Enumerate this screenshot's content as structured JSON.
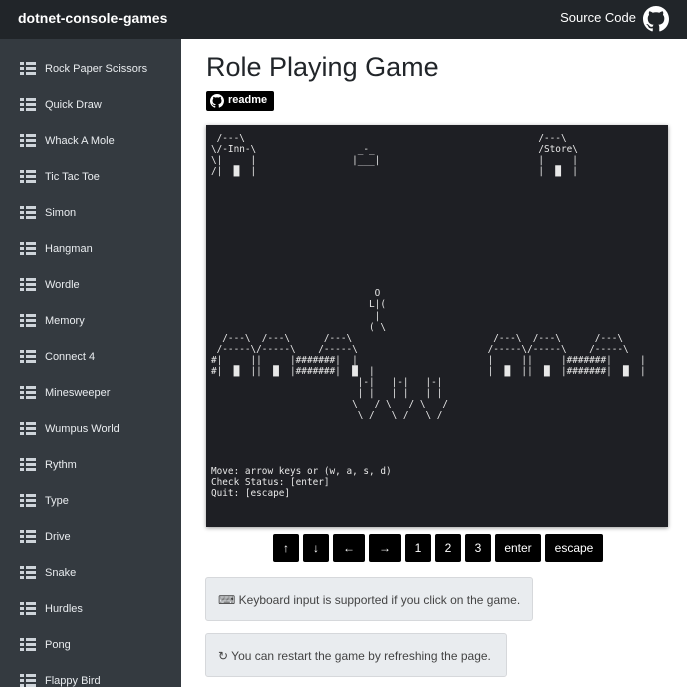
{
  "header": {
    "brand": "dotnet-console-games",
    "source_code_label": "Source Code",
    "github_icon": "github-icon"
  },
  "sidebar": {
    "items": [
      {
        "label": "Rock Paper Scissors",
        "icon": "list-icon"
      },
      {
        "label": "Quick Draw",
        "icon": "list-icon"
      },
      {
        "label": "Whack A Mole",
        "icon": "list-icon"
      },
      {
        "label": "Tic Tac Toe",
        "icon": "list-icon"
      },
      {
        "label": "Simon",
        "icon": "list-icon"
      },
      {
        "label": "Hangman",
        "icon": "list-icon"
      },
      {
        "label": "Wordle",
        "icon": "list-icon"
      },
      {
        "label": "Memory",
        "icon": "list-icon"
      },
      {
        "label": "Connect 4",
        "icon": "list-icon"
      },
      {
        "label": "Minesweeper",
        "icon": "list-icon"
      },
      {
        "label": "Wumpus World",
        "icon": "list-icon"
      },
      {
        "label": "Rythm",
        "icon": "list-icon"
      },
      {
        "label": "Type",
        "icon": "list-icon"
      },
      {
        "label": "Drive",
        "icon": "list-icon"
      },
      {
        "label": "Snake",
        "icon": "list-icon"
      },
      {
        "label": "Hurdles",
        "icon": "list-icon"
      },
      {
        "label": "Pong",
        "icon": "list-icon"
      },
      {
        "label": "Flappy Bird",
        "icon": "list-icon"
      }
    ]
  },
  "main": {
    "title": "Role Playing Game",
    "readme_label": "readme",
    "game_screen": " /---\\                                                    /---\\\n\\/-Inn-\\                  _-_                             /Store\\\n\\|     |                 |___|                            |     |\n/|  █  |                                                  |  █  |\n\n\n\n\n\n\n\n\n\n\n                             O\n                            L|(\n                             |\n                            ( \\\n  /---\\  /---\\      /---\\                         /---\\  /---\\      /---\\\n /-----\\/-----\\    /-----\\                       /-----\\/-----\\    /-----\\\n#|     ||     |#######|  |                       |     ||     |#######|     |\n#|  █  ||  █  |#######|  █  |                    |  █  ||  █  |#######|  █  |\n                          |-|   |-|   |-|\n                          | |   | |   | |\n                         \\   / \\   / \\   /\n                          \\ /   \\ /   \\ /\n\n\n\n\nMove: arrow keys or (w, a, s, d)\nCheck Status: [enter]\nQuit: [escape]",
    "keys": [
      "↑",
      "↓",
      "←",
      "→",
      "1",
      "2",
      "3",
      "enter",
      "escape"
    ],
    "hint_keyboard": "⌨ Keyboard input is supported if you click on the game.",
    "hint_restart": "↻ You can restart the game by refreshing the page."
  }
}
